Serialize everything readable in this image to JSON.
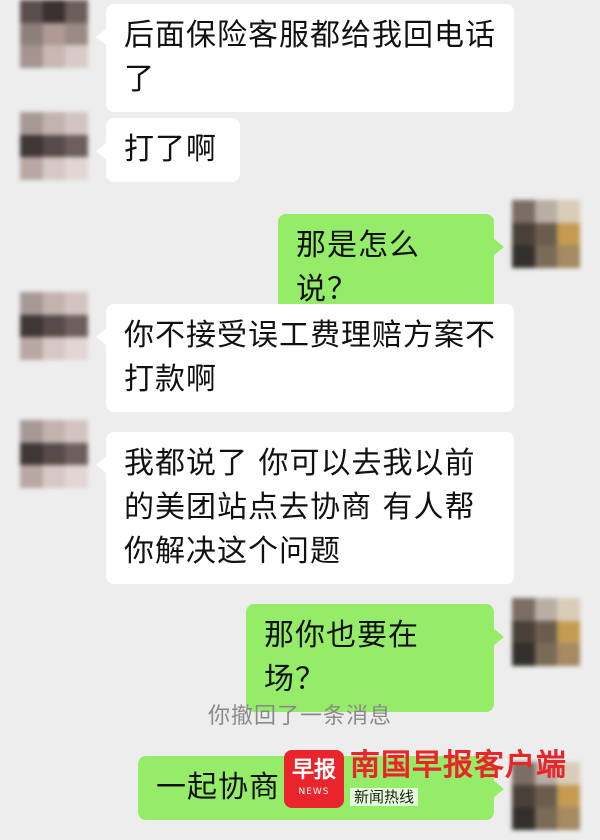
{
  "messages": [
    {
      "direction": "in",
      "text": "后面保险客服都给我回电话了"
    },
    {
      "direction": "in",
      "text": "打了啊"
    },
    {
      "direction": "out",
      "text": "那是怎么说？"
    },
    {
      "direction": "in",
      "text": "你不接受误工费理赔方案不打款啊"
    },
    {
      "direction": "in",
      "text": "我都说了 你可以去我以前的美团站点去协商 有人帮你解决这个问题"
    },
    {
      "direction": "out",
      "text": "那你也要在场？"
    },
    {
      "direction": "out",
      "text": "一起协商"
    }
  ],
  "system_notice": "你撤回了一条消息",
  "watermark": {
    "logo_text": "早报",
    "logo_sub": "NEWS",
    "title": "南国早报客户端",
    "subtitle": "新闻热线"
  },
  "colors": {
    "background": "#ededed",
    "incoming_bubble": "#ffffff",
    "outgoing_bubble": "#95ec69",
    "watermark_red": "#e9242a"
  }
}
